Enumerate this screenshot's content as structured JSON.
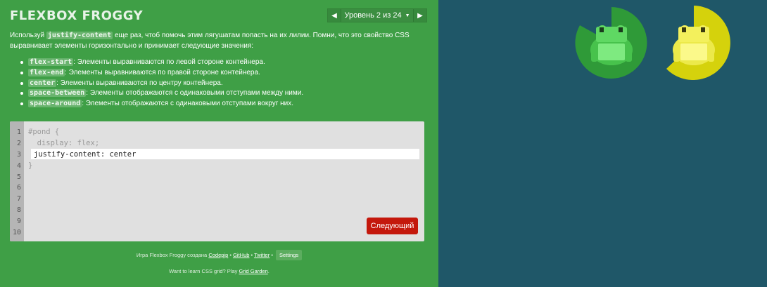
{
  "header": {
    "title": "Flexbox Froggy",
    "level_label": "Уровень 2 из 24",
    "prev_icon": "triangle-left-icon",
    "next_icon": "triangle-right-icon",
    "caret_icon": "caret-down-icon"
  },
  "instructions": {
    "intro_1": "Используй",
    "intro_code": "justify-content",
    "intro_2": "еще раз, чтоб помочь этим лягушатам попасть на их лилии. Помни, что это свойство CSS выравнивает элементы горизонтально и принимает следующие значения:",
    "values": [
      {
        "code": "flex-start",
        "text": ": Элементы выравниваются по левой стороне контейнера."
      },
      {
        "code": "flex-end",
        "text": ": Элементы выравниваются по правой стороне контейнера."
      },
      {
        "code": "center",
        "text": ": Элементы выравниваются по центру контейнера."
      },
      {
        "code": "space-between",
        "text": ": Элементы отображаются с одинаковыми отступами между ними."
      },
      {
        "code": "space-around",
        "text": ": Элементы отображаются с одинаковыми отступами вокруг них."
      }
    ]
  },
  "editor": {
    "line_numbers": [
      "1",
      "2",
      "3",
      "4",
      "5",
      "6",
      "7",
      "8",
      "9",
      "10"
    ],
    "line1": "#pond {",
    "line2": "  display: flex;",
    "line4": "}",
    "input_value": "justify-content: center",
    "next_label": "Следующий"
  },
  "credits": {
    "prefix": "Игра Flexbox Froggy создана",
    "codepip": "Codepip",
    "github": "GitHub",
    "twitter": "Twitter",
    "settings": "Settings",
    "sep": "•",
    "grid_prefix": "Want to learn CSS grid? Play",
    "grid_link": "Grid Garden",
    "grid_suffix": "."
  },
  "colors": {
    "sidebar": "#3f9f46",
    "pond": "#1f5768",
    "green_lily": "#2f9a38",
    "green_frog": "#72e075",
    "yellow_lily": "#d5d20c",
    "yellow_frog": "#f5f36a",
    "next_button": "#c4180c"
  },
  "board": {
    "frogs": [
      {
        "color": "green",
        "name": "green-frog"
      },
      {
        "color": "yellow",
        "name": "yellow-frog"
      }
    ]
  }
}
